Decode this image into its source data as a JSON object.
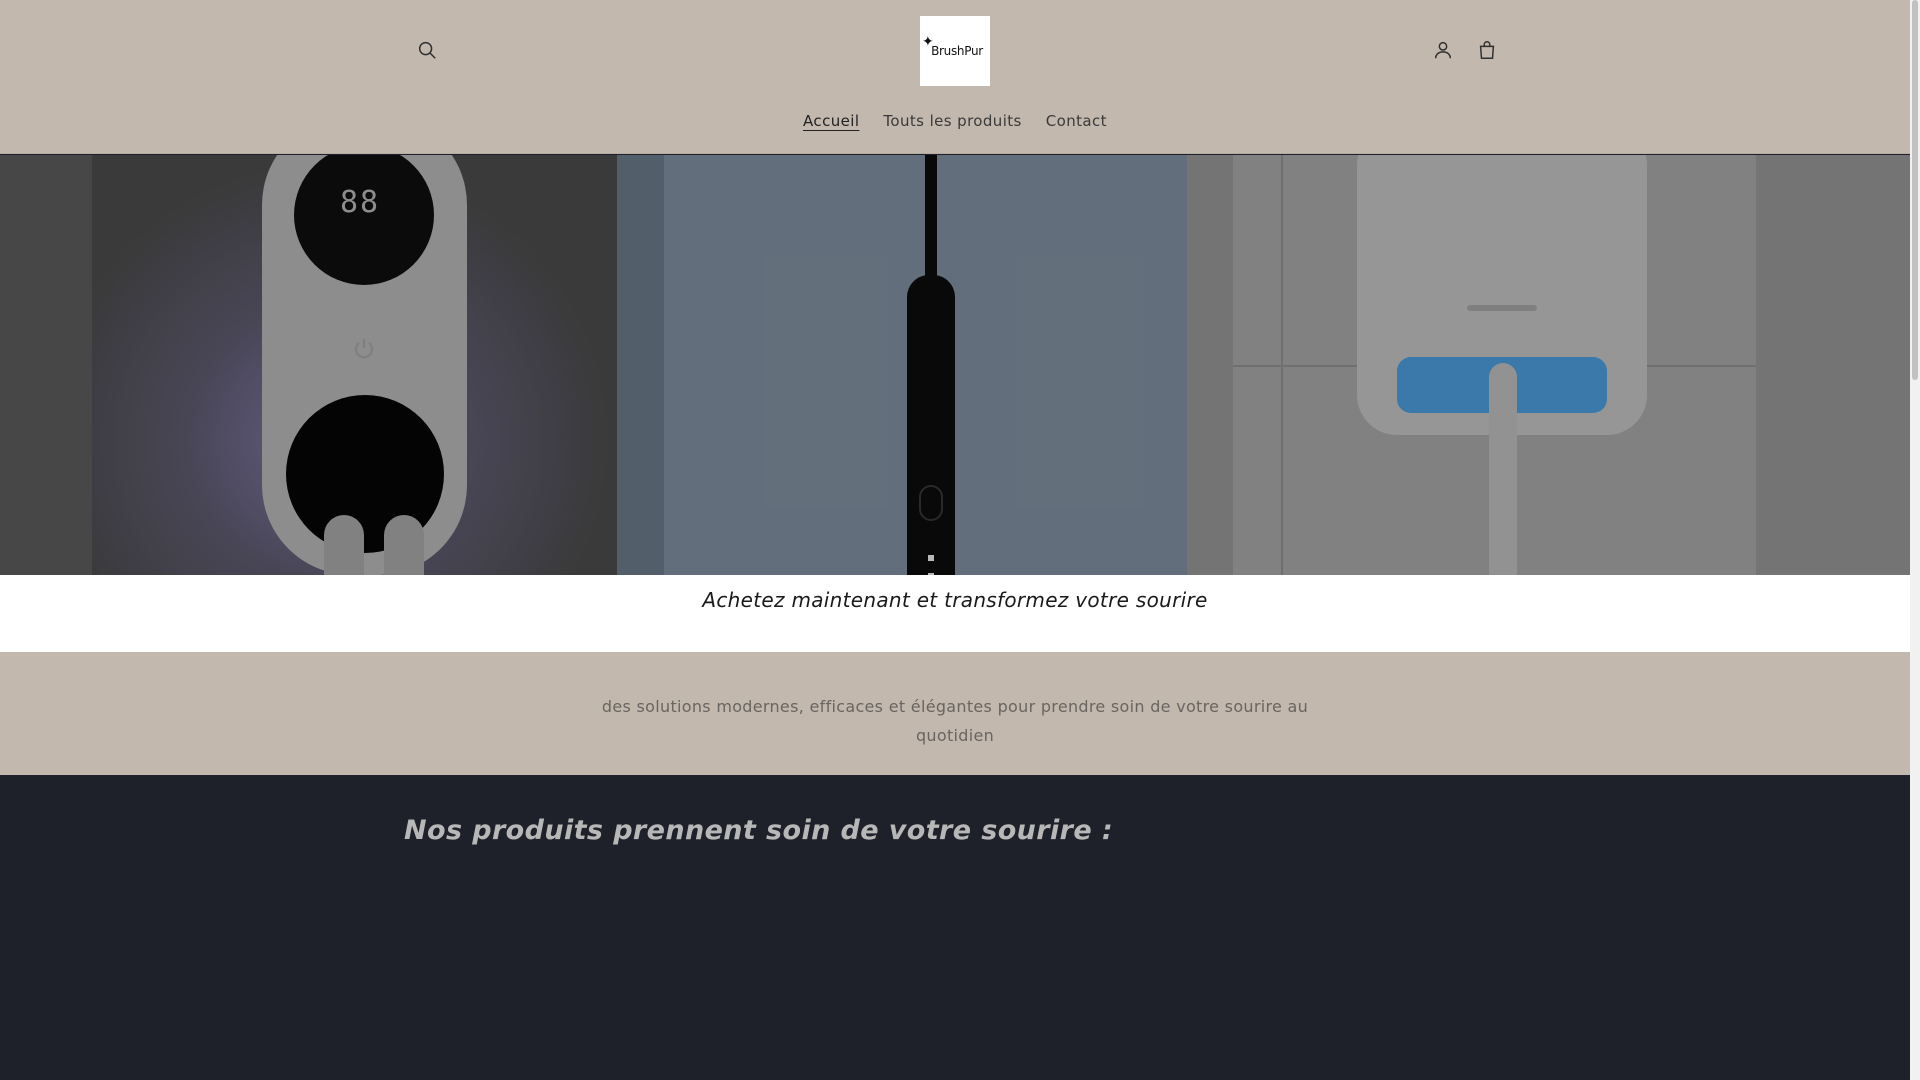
{
  "header": {
    "logo_text": "BrushPur",
    "search_icon": "search-icon",
    "account_icon": "account-icon",
    "cart_icon": "cart-icon"
  },
  "nav": {
    "items": [
      {
        "label": "Accueil",
        "active": true
      },
      {
        "label": "Touts les produits",
        "active": false
      },
      {
        "label": "Contact",
        "active": false
      }
    ]
  },
  "hero": {
    "panel_1_digits": "88"
  },
  "tagline": {
    "text": "Achetez maintenant et transformez votre sourire"
  },
  "description": {
    "text": "des solutions modernes, efficaces et élégantes pour prendre soin de votre sourire au quotidien"
  },
  "products": {
    "title": "Nos produits prennent soin de votre sourire :"
  },
  "colors": {
    "header_bg": "#c2b8ad",
    "dark_bg": "#1e212a",
    "accent_blue": "#3f84b8"
  }
}
